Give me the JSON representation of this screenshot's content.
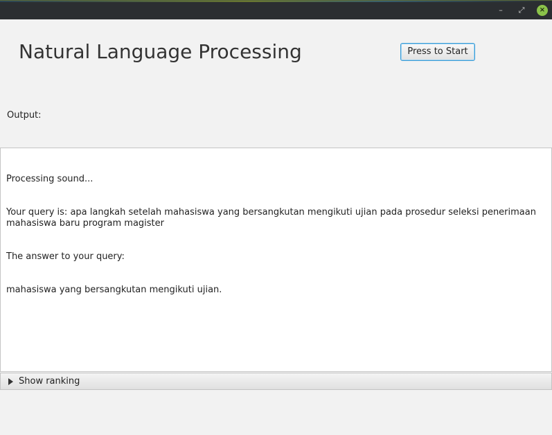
{
  "window": {
    "minimize_glyph": "–",
    "maximize_glyph": "⤢",
    "close_glyph": "×"
  },
  "app": {
    "title": "Natural Language Processing",
    "start_button_label": "Press to Start"
  },
  "output": {
    "label": "Output:",
    "lines": [
      "Processing sound...",
      "Your query is: apa langkah setelah mahasiswa yang bersangkutan mengikuti ujian pada prosedur seleksi penerimaan mahasiswa baru program magister",
      "The answer to your query:",
      "mahasiswa yang bersangkutan mengikuti ujian."
    ]
  },
  "ranking": {
    "label": "Show ranking",
    "expanded": false
  },
  "colors": {
    "accent_border": "#3a9bd5",
    "close_button": "#8bc34a",
    "titlebar": "#2b2e31",
    "background": "#f2f2f2"
  }
}
